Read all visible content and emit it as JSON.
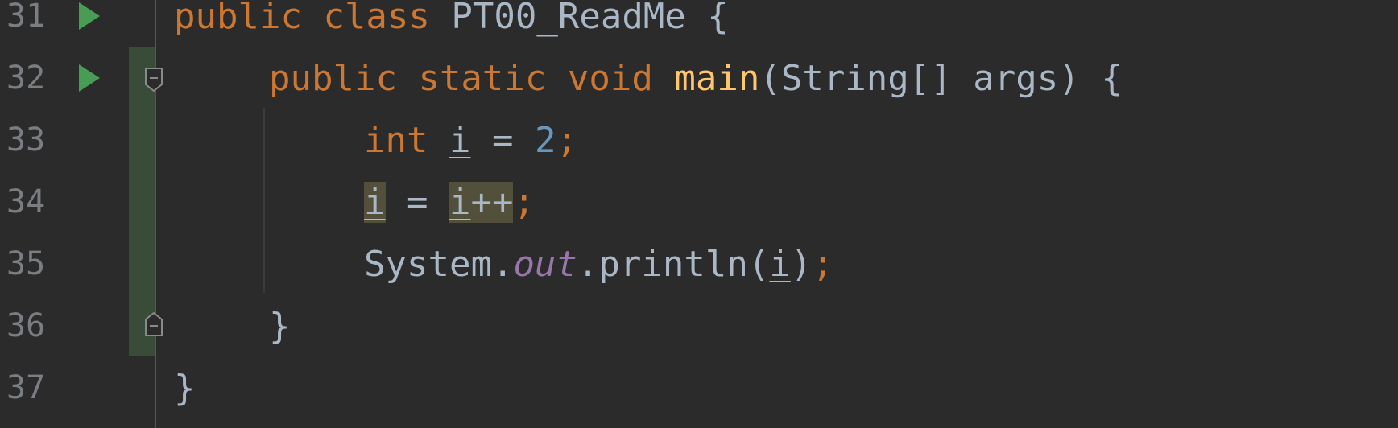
{
  "editor": {
    "language": "Java",
    "colors": {
      "background": "#2b2b2b",
      "line_number": "#7a7e82",
      "keyword": "#cc7832",
      "function": "#ffc66d",
      "number": "#6897bb",
      "field": "#9876aa",
      "text": "#a9b7c6",
      "run_icon": "#499c54",
      "highlight": "#52503a",
      "change_marker": "#384c38"
    },
    "lines": [
      {
        "number": "31",
        "tokens": {
          "t1": "public",
          "t2": " ",
          "t3": "class",
          "t4": " PT00_ReadMe {"
        }
      },
      {
        "number": "32",
        "tokens": {
          "t1": "public",
          "t2": " ",
          "t3": "static",
          "t4": " ",
          "t5": "void",
          "t6": " ",
          "t7": "main",
          "t8": "(String[] args) {"
        }
      },
      {
        "number": "33",
        "tokens": {
          "t1": "int",
          "t2": " ",
          "t3": "i",
          "t4": " = ",
          "t5": "2",
          "t6": ";"
        }
      },
      {
        "number": "34",
        "tokens": {
          "t1": "i",
          "t2": " = ",
          "t3": "i",
          "t4": "++",
          "t5": ";"
        }
      },
      {
        "number": "35",
        "tokens": {
          "t1": "System.",
          "t2": "out",
          "t3": ".println(",
          "t4": "i",
          "t5": ")",
          "t6": ";"
        }
      },
      {
        "number": "36",
        "tokens": {
          "t1": "}"
        }
      },
      {
        "number": "37",
        "tokens": {
          "t1": "}"
        }
      }
    ]
  }
}
